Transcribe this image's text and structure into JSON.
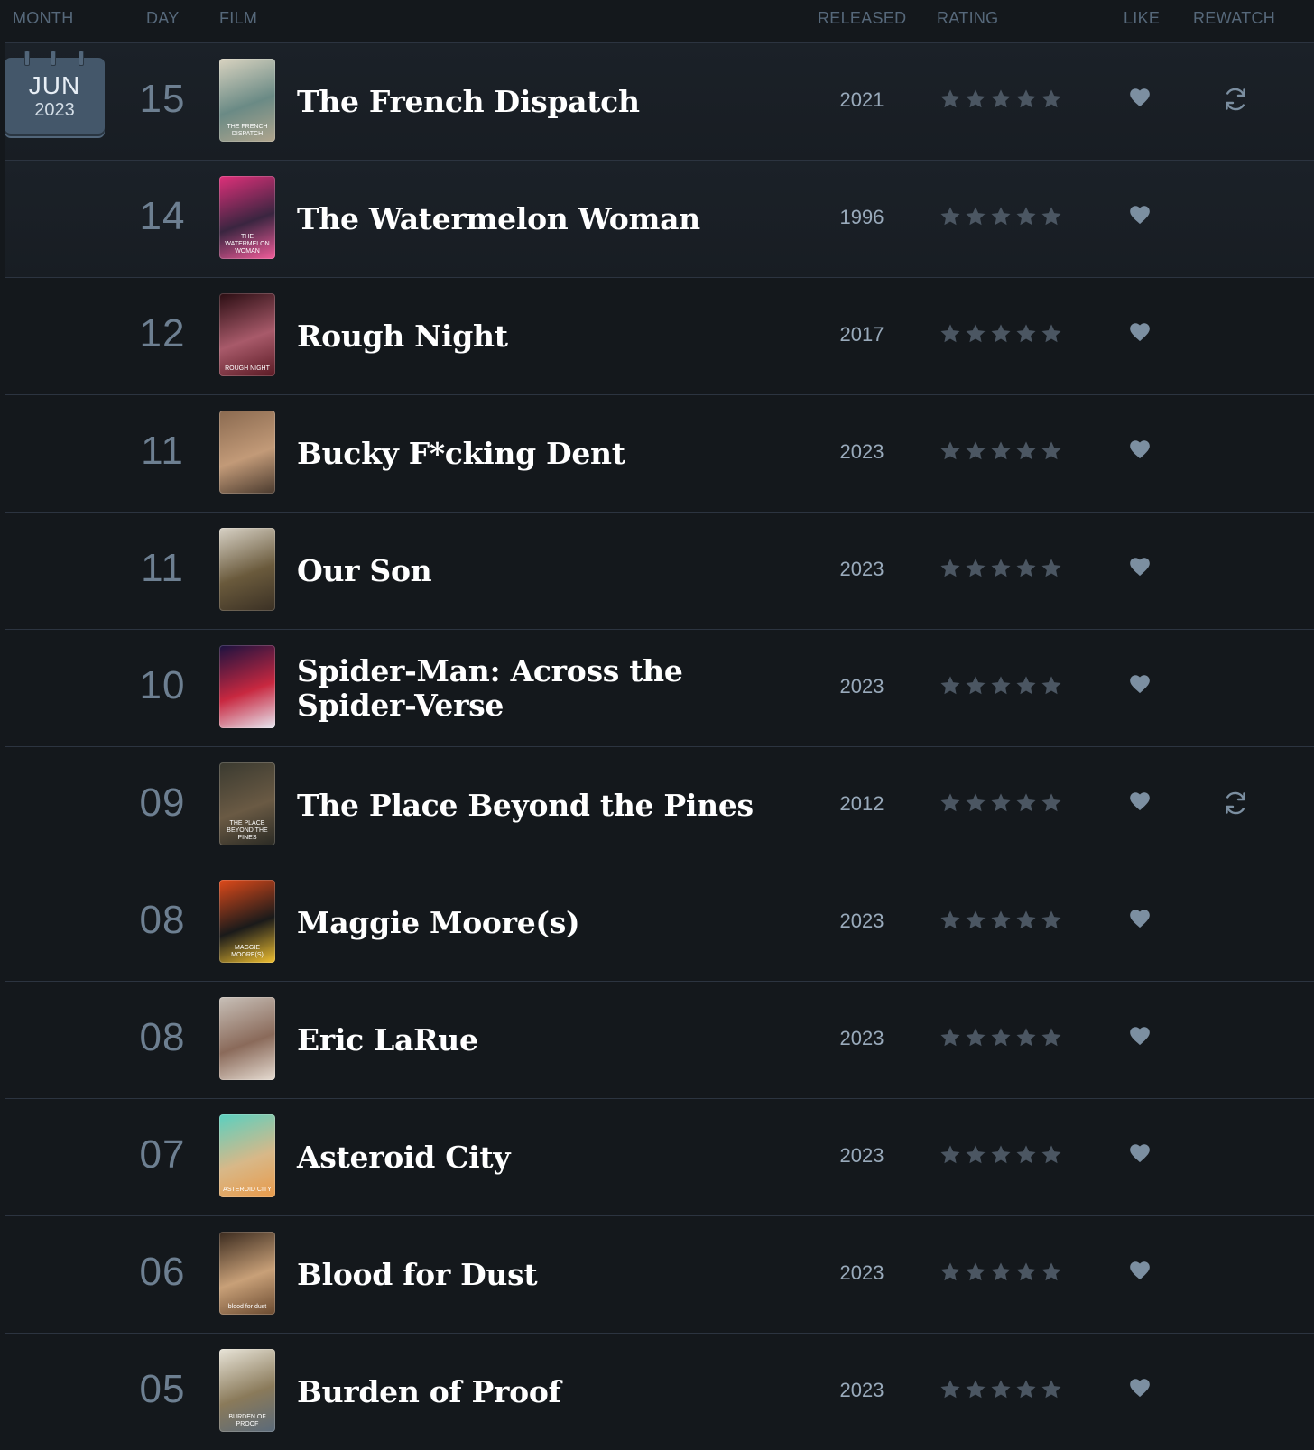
{
  "header": {
    "month": "MONTH",
    "day": "DAY",
    "film": "FILM",
    "released": "RELEASED",
    "rating": "RATING",
    "like": "LIKE",
    "rewatch": "REWATCH"
  },
  "calendar": {
    "month": "JUN",
    "year": "2023"
  },
  "colors": {
    "star": "#4b5662",
    "heart": "#7c8fa1",
    "rewatch": "#7c8fa1",
    "title": "#ffffff"
  },
  "icons": {
    "star": "star-icon",
    "like": "heart-icon",
    "rewatch": "rewatch-icon",
    "calendar": "calendar-icon"
  },
  "entries": [
    {
      "day": "15",
      "title": "The French Dispatch",
      "released": "2021",
      "stars": 5,
      "liked": true,
      "rewatch": true,
      "poster_label": "THE FRENCH DISPATCH",
      "poster_colors": [
        "#d9d3c0",
        "#6a8a85",
        "#b0a58d"
      ]
    },
    {
      "day": "14",
      "title": "The Watermelon Woman",
      "released": "1996",
      "stars": 5,
      "liked": true,
      "rewatch": false,
      "poster_label": "THE WATERMELON WOMAN",
      "poster_colors": [
        "#e0307a",
        "#3a2540",
        "#f25c9a"
      ]
    },
    {
      "day": "12",
      "title": "Rough Night",
      "released": "2017",
      "stars": 5,
      "liked": true,
      "rewatch": false,
      "poster_label": "ROUGH NIGHT",
      "poster_colors": [
        "#2a0d12",
        "#a85a6a",
        "#5a1a24"
      ]
    },
    {
      "day": "11",
      "title": "Bucky F*cking Dent",
      "released": "2023",
      "stars": 5,
      "liked": true,
      "rewatch": false,
      "poster_label": "",
      "poster_colors": [
        "#8a6a50",
        "#c29a78",
        "#4a3a2e"
      ]
    },
    {
      "day": "11",
      "title": "Our Son",
      "released": "2023",
      "stars": 5,
      "liked": true,
      "rewatch": false,
      "poster_label": "",
      "poster_colors": [
        "#d8d2c6",
        "#6a5a3c",
        "#3a3024"
      ]
    },
    {
      "day": "10",
      "title": "Spider-Man: Across the Spider-Verse",
      "released": "2023",
      "stars": 5,
      "liked": true,
      "rewatch": false,
      "poster_label": "",
      "poster_colors": [
        "#1a1240",
        "#c82840",
        "#e6e6f0"
      ]
    },
    {
      "day": "09",
      "title": "The Place Beyond the Pines",
      "released": "2012",
      "stars": 5,
      "liked": true,
      "rewatch": true,
      "poster_label": "THE PLACE BEYOND THE PINES",
      "poster_colors": [
        "#3a3a30",
        "#6a5a44",
        "#2a2a24"
      ]
    },
    {
      "day": "08",
      "title": "Maggie Moore(s)",
      "released": "2023",
      "stars": 5,
      "liked": true,
      "rewatch": false,
      "poster_label": "MAGGIE MOORE(S)",
      "poster_colors": [
        "#e04a1a",
        "#1a1a1a",
        "#f0c030"
      ]
    },
    {
      "day": "08",
      "title": "Eric LaRue",
      "released": "2023",
      "stars": 5,
      "liked": true,
      "rewatch": false,
      "poster_label": "",
      "poster_colors": [
        "#c8c0b8",
        "#8a6a5a",
        "#e6dcd2"
      ]
    },
    {
      "day": "07",
      "title": "Asteroid City",
      "released": "2023",
      "stars": 5,
      "liked": true,
      "rewatch": false,
      "poster_label": "ASTEROID CITY",
      "poster_colors": [
        "#5ad0c0",
        "#d8b888",
        "#e89a4a"
      ]
    },
    {
      "day": "06",
      "title": "Blood for Dust",
      "released": "2023",
      "stars": 5,
      "liked": true,
      "rewatch": false,
      "poster_label": "blood for dust",
      "poster_colors": [
        "#3a2a1e",
        "#c8a078",
        "#6a4a30"
      ]
    },
    {
      "day": "05",
      "title": "Burden of Proof",
      "released": "2023",
      "stars": 5,
      "liked": true,
      "rewatch": false,
      "poster_label": "BURDEN OF PROOF",
      "poster_colors": [
        "#e8e4d8",
        "#8a7a5a",
        "#5a6a7a"
      ]
    }
  ]
}
